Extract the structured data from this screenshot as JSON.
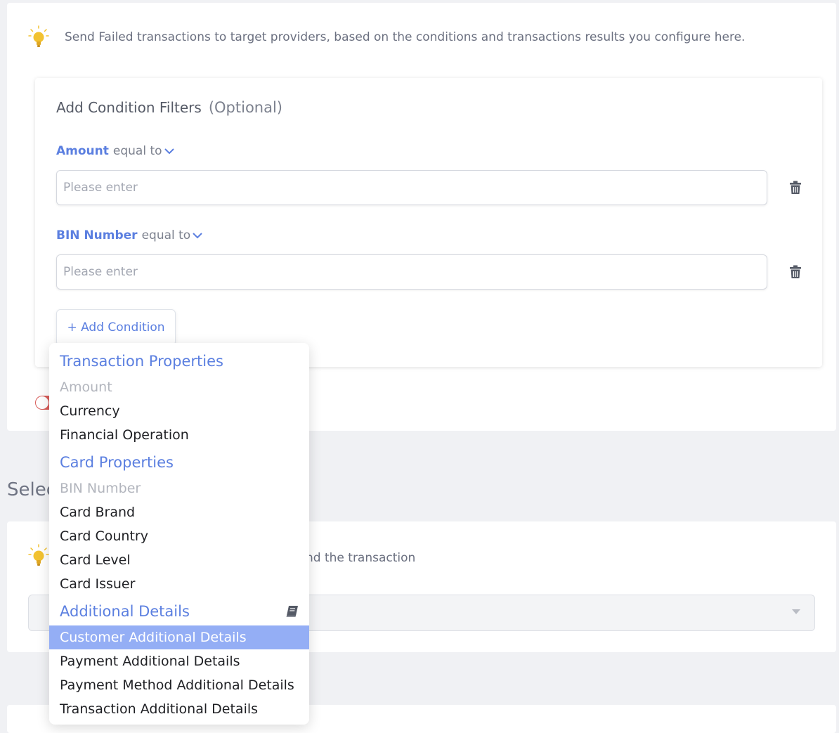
{
  "top_panel": {
    "tip": "Send Failed transactions to target providers, based on the conditions and transactions results you configure here.",
    "condition_card": {
      "title": "Add Condition Filters",
      "optional": "(Optional)",
      "conditions": [
        {
          "field": "Amount",
          "operator": "equal to",
          "placeholder": "Please enter"
        },
        {
          "field": "BIN Number",
          "operator": "equal to",
          "placeholder": "Please enter"
        }
      ],
      "add_button": "+ Add Condition"
    }
  },
  "section": {
    "title": "Selec",
    "tip": "nd the transaction"
  },
  "dropdown": {
    "groups": [
      {
        "label": "Transaction Properties",
        "items": [
          {
            "label": "Amount",
            "state": "disabled"
          },
          {
            "label": "Currency",
            "state": "normal"
          },
          {
            "label": "Financial Operation",
            "state": "normal"
          }
        ]
      },
      {
        "label": "Card Properties",
        "items": [
          {
            "label": "BIN Number",
            "state": "disabled"
          },
          {
            "label": "Card Brand",
            "state": "normal"
          },
          {
            "label": "Card Country",
            "state": "normal"
          },
          {
            "label": "Card Level",
            "state": "normal"
          },
          {
            "label": "Card Issuer",
            "state": "normal"
          }
        ]
      },
      {
        "label": "Additional Details",
        "icon": "book-icon",
        "items": [
          {
            "label": "Customer Additional Details",
            "state": "selected"
          },
          {
            "label": "Payment Additional Details",
            "state": "normal"
          },
          {
            "label": "Payment Method Additional Details",
            "state": "normal"
          },
          {
            "label": "Transaction Additional Details",
            "state": "normal"
          }
        ]
      }
    ]
  },
  "colors": {
    "accent": "#5b7fe0",
    "selected_bg": "#94aef5",
    "toggle_off": "#d85d5a",
    "bulb": "#f2c230"
  }
}
